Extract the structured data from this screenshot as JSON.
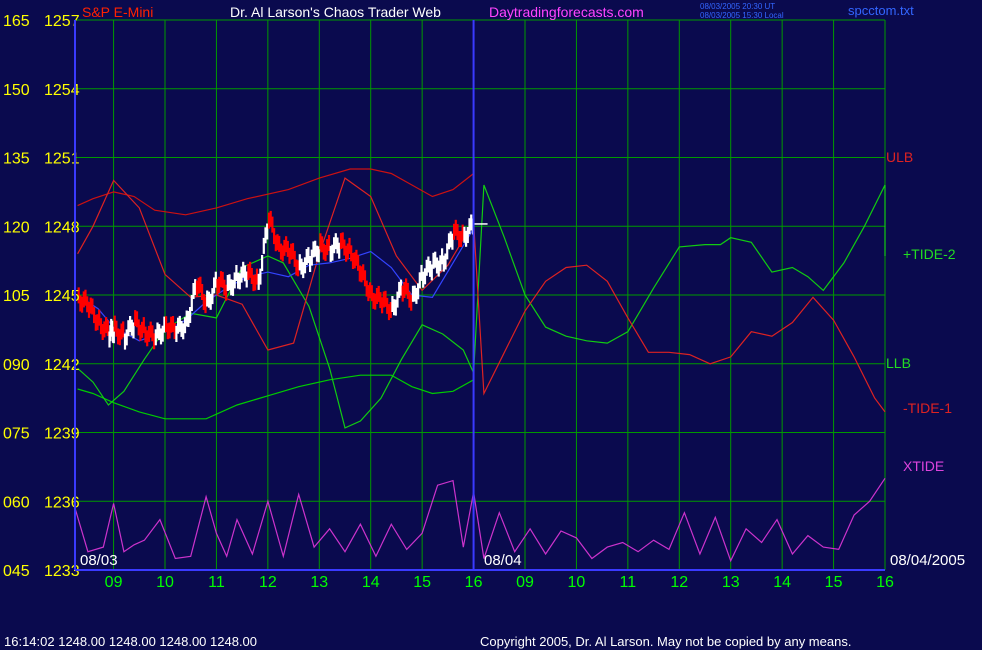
{
  "header": {
    "instrument": "S&P E-Mini",
    "title": "Dr. Al Larson's Chaos Trader Web",
    "site": "Daytradingforecasts.com",
    "timestamp_ut": "08/03/2005 20:30 UT",
    "timestamp_local": "08/03/2005 15:30 Local",
    "filename": "spcctom.txt"
  },
  "footer": {
    "quote": "16:14:02  1248.00 1248.00 1248.00 1248.00",
    "copyright": "Copyright 2005, Dr. Al Larson. May not be copied by any means."
  },
  "colors": {
    "background": "#0a0a4e",
    "grid": "#009a00",
    "axis": "#3a3aff",
    "price_yellow": "#ffff00",
    "date_green": "#00ff00",
    "ulb": "#cc1111",
    "llb": "#00cc00",
    "tide2": "#11cc11",
    "tide1": "#dd2222",
    "xtide": "#cc33cc",
    "bars_up": "#ffffff",
    "bars_down": "#ff0000",
    "moving_avg": "#3344ff"
  },
  "chart_data": {
    "type": "line",
    "y_labels": [
      {
        "left": "165",
        "right": "1257"
      },
      {
        "left": "150",
        "right": "1254"
      },
      {
        "left": "135",
        "right": "1251"
      },
      {
        "left": "120",
        "right": "1248"
      },
      {
        "left": "105",
        "right": "1245"
      },
      {
        "left": "090",
        "right": "1242"
      },
      {
        "left": "075",
        "right": "1239"
      },
      {
        "left": "060",
        "right": "1236"
      },
      {
        "left": "045",
        "right": "1233"
      }
    ],
    "ylim": [
      1233,
      1257
    ],
    "x_ticks": [
      "09",
      "10",
      "11",
      "12",
      "13",
      "14",
      "15",
      "16",
      "09",
      "10",
      "11",
      "12",
      "13",
      "14",
      "15",
      "16"
    ],
    "date_labels": {
      "start": "08/03",
      "mid": "08/04",
      "end": "08/04/2005"
    },
    "x_range_hours": [
      8.25,
      24.0
    ],
    "series_labels": [
      "ULB",
      "+TIDE-2",
      "LLB",
      "-TIDE-1",
      "XTIDE"
    ],
    "series": [
      {
        "name": "ULB",
        "x": [
          8.3,
          8.6,
          9.0,
          9.4,
          9.8,
          10.4,
          11.0,
          11.6,
          12.4,
          13.0,
          13.6,
          14.0,
          14.4,
          14.8,
          15.2,
          15.6,
          16.0
        ],
        "y": [
          1248.9,
          1249.2,
          1249.5,
          1249.3,
          1248.7,
          1248.5,
          1248.8,
          1249.2,
          1249.6,
          1250.1,
          1250.5,
          1250.5,
          1250.3,
          1249.8,
          1249.3,
          1249.6,
          1250.3
        ]
      },
      {
        "name": "LLB",
        "x": [
          8.3,
          8.6,
          9.0,
          9.5,
          10.0,
          10.8,
          11.4,
          12.0,
          12.6,
          13.2,
          13.8,
          14.4,
          14.8,
          15.2,
          15.6,
          16.0
        ],
        "y": [
          1240.9,
          1240.7,
          1240.3,
          1239.9,
          1239.6,
          1239.6,
          1240.2,
          1240.6,
          1241.0,
          1241.3,
          1241.5,
          1241.5,
          1241.0,
          1240.7,
          1240.8,
          1241.3
        ]
      },
      {
        "name": "+TIDE-2",
        "x": [
          8.3,
          8.6,
          8.9,
          9.2,
          9.6,
          10.0,
          10.5,
          11.0,
          11.5,
          12.0,
          12.3,
          12.8,
          13.2,
          13.5,
          13.8,
          14.2,
          14.6,
          15.0,
          15.4,
          15.8,
          16.0,
          16.2,
          16.6,
          17.0,
          17.4,
          17.8,
          18.2,
          18.6,
          19.0,
          19.5,
          20.0,
          20.5,
          20.8,
          21.0,
          21.4,
          21.8,
          22.2,
          22.5,
          22.8,
          23.2,
          23.6,
          24.0,
          24.0
        ],
        "y": [
          1241.8,
          1241.2,
          1240.2,
          1240.8,
          1242.2,
          1243.5,
          1244.2,
          1244.0,
          1246.2,
          1246.7,
          1246.4,
          1244.5,
          1241.8,
          1239.2,
          1239.5,
          1240.5,
          1242.2,
          1243.7,
          1243.3,
          1242.6,
          1241.6,
          1249.8,
          1247.5,
          1245.0,
          1243.6,
          1243.2,
          1243.0,
          1242.9,
          1243.4,
          1245.3,
          1247.1,
          1247.2,
          1247.2,
          1247.5,
          1247.3,
          1246.0,
          1246.2,
          1245.8,
          1245.2,
          1246.4,
          1248.0,
          1249.8,
          1246.7
        ]
      },
      {
        "name": "-TIDE-1",
        "x": [
          8.3,
          8.6,
          9.0,
          9.5,
          10.0,
          10.5,
          11.0,
          11.5,
          12.0,
          12.5,
          13.0,
          13.5,
          14.0,
          14.5,
          15.0,
          15.5,
          16.0,
          16.2,
          16.6,
          17.0,
          17.4,
          17.8,
          18.2,
          18.6,
          19.0,
          19.4,
          19.8,
          20.2,
          20.6,
          21.0,
          21.4,
          21.8,
          22.2,
          22.6,
          23.0,
          23.4,
          23.8,
          24.0
        ],
        "y": [
          1246.8,
          1248.0,
          1250.0,
          1248.8,
          1245.9,
          1244.9,
          1245.0,
          1244.6,
          1242.6,
          1242.9,
          1246.8,
          1250.1,
          1249.3,
          1246.7,
          1245.2,
          1246.3,
          1248.2,
          1240.7,
          1242.5,
          1244.3,
          1245.6,
          1246.2,
          1246.3,
          1245.6,
          1244.0,
          1242.5,
          1242.5,
          1242.4,
          1242.0,
          1242.3,
          1243.4,
          1243.2,
          1243.8,
          1244.9,
          1243.9,
          1242.3,
          1240.5,
          1239.9
        ]
      },
      {
        "name": "XTIDE",
        "x": [
          8.25,
          8.5,
          8.8,
          9.0,
          9.2,
          9.4,
          9.6,
          9.9,
          10.2,
          10.5,
          10.8,
          11.0,
          11.2,
          11.4,
          11.7,
          12.0,
          12.3,
          12.6,
          12.9,
          13.2,
          13.5,
          13.8,
          14.1,
          14.4,
          14.7,
          15.0,
          15.3,
          15.6,
          15.8,
          16.0,
          16.2,
          16.5,
          16.8,
          17.1,
          17.4,
          17.7,
          18.0,
          18.3,
          18.6,
          18.9,
          19.2,
          19.5,
          19.8,
          20.1,
          20.4,
          20.7,
          21.0,
          21.3,
          21.6,
          21.9,
          22.2,
          22.5,
          22.8,
          23.1,
          23.4,
          23.7,
          24.0
        ],
        "y": [
          1235.7,
          1233.8,
          1234.0,
          1235.9,
          1233.8,
          1234.1,
          1234.3,
          1235.2,
          1233.5,
          1233.6,
          1236.2,
          1234.6,
          1233.6,
          1235.2,
          1233.7,
          1236.0,
          1233.6,
          1236.3,
          1234.0,
          1234.8,
          1233.8,
          1235.0,
          1233.6,
          1235.0,
          1233.9,
          1234.6,
          1236.7,
          1236.9,
          1234.0,
          1236.4,
          1233.5,
          1235.5,
          1233.8,
          1234.8,
          1233.7,
          1234.7,
          1234.4,
          1233.5,
          1234.0,
          1234.2,
          1233.8,
          1234.3,
          1233.9,
          1235.5,
          1233.7,
          1235.3,
          1233.4,
          1234.8,
          1234.2,
          1235.2,
          1233.7,
          1234.5,
          1234.0,
          1233.9,
          1235.4,
          1236.0,
          1237.0
        ]
      },
      {
        "name": "moving-average",
        "x": [
          8.3,
          8.7,
          9.0,
          9.5,
          10.0,
          10.4,
          10.8,
          11.2,
          11.6,
          12.0,
          12.4,
          12.8,
          13.2,
          13.6,
          14.0,
          14.4,
          14.8,
          15.2,
          15.6,
          16.0
        ],
        "y": [
          1245.0,
          1244.4,
          1243.6,
          1243.0,
          1243.4,
          1243.9,
          1244.7,
          1245.3,
          1245.8,
          1246.0,
          1245.8,
          1246.3,
          1246.4,
          1246.6,
          1246.9,
          1246.2,
          1245.0,
          1244.9,
          1246.4,
          1247.9
        ]
      },
      {
        "name": "price",
        "x": [
          8.3,
          8.5,
          8.7,
          8.9,
          9.0,
          9.2,
          9.4,
          9.6,
          9.8,
          10.0,
          10.2,
          10.4,
          10.6,
          10.8,
          11.0,
          11.2,
          11.4,
          11.6,
          11.8,
          12.0,
          12.2,
          12.4,
          12.6,
          12.8,
          13.0,
          13.2,
          13.4,
          13.6,
          13.8,
          14.0,
          14.2,
          14.4,
          14.6,
          14.8,
          15.0,
          15.2,
          15.4,
          15.6,
          15.8,
          16.0
        ],
        "y": [
          1244.9,
          1244.5,
          1243.8,
          1243.3,
          1243.5,
          1243.2,
          1243.8,
          1243.4,
          1243.1,
          1243.7,
          1243.4,
          1243.8,
          1245.5,
          1244.6,
          1245.6,
          1245.3,
          1245.8,
          1245.9,
          1245.6,
          1248.3,
          1247.1,
          1246.9,
          1246.2,
          1246.6,
          1247.1,
          1247.0,
          1247.2,
          1246.9,
          1245.9,
          1245.0,
          1244.7,
          1244.4,
          1245.3,
          1244.8,
          1245.9,
          1246.3,
          1246.5,
          1247.7,
          1247.6,
          1248.1
        ]
      }
    ],
    "vertical_marker_hour": 16.0,
    "grid": true
  }
}
